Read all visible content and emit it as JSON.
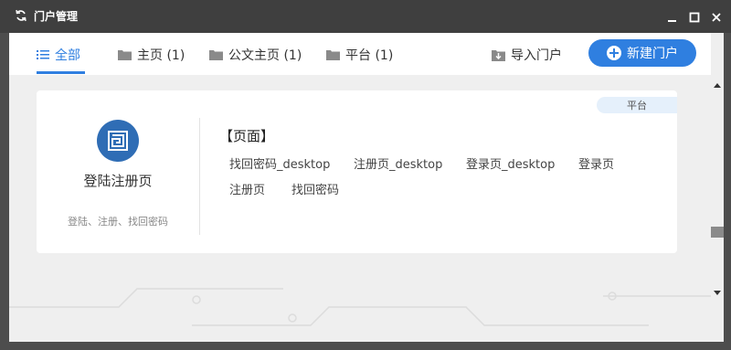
{
  "window": {
    "title": "门户管理"
  },
  "tabs": [
    {
      "label": "全部",
      "icon": "list-icon"
    },
    {
      "label": "主页 (1)",
      "icon": "folder-icon"
    },
    {
      "label": "公文主页 (1)",
      "icon": "folder-icon"
    },
    {
      "label": "平台 (1)",
      "icon": "folder-icon"
    }
  ],
  "actions": {
    "import_label": "导入门户",
    "new_label": "新建门户"
  },
  "card": {
    "badge": "平台",
    "title": "登陆注册页",
    "description": "登陆、注册、找回密码",
    "section_title": "【页面】",
    "pages": [
      "找回密码_desktop",
      "注册页_desktop",
      "登录页_desktop",
      "登录页",
      "注册页",
      "找回密码"
    ]
  },
  "colors": {
    "accent": "#2f7fe0",
    "titlebar": "#3f3f3f",
    "logo": "#2f6db5"
  }
}
